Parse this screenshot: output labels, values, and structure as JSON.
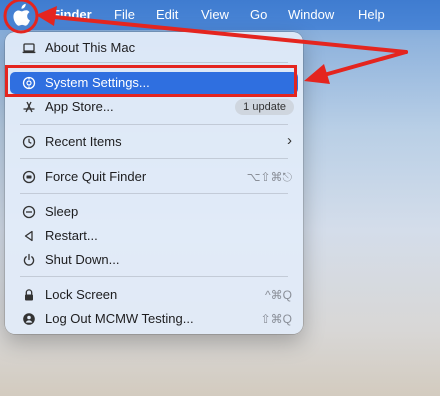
{
  "menubar": {
    "app_name": "Finder",
    "items": [
      "File",
      "Edit",
      "View",
      "Go",
      "Window",
      "Help"
    ]
  },
  "apple_menu": {
    "items": [
      {
        "label": "About This Mac",
        "icon": "laptop-icon"
      },
      {
        "label": "System Settings...",
        "icon": "gear-icon",
        "selected": true
      },
      {
        "label": "App Store...",
        "icon": "app-store-icon",
        "badge": "1 update"
      },
      {
        "label": "Recent Items",
        "icon": "clock-icon",
        "submenu": true
      },
      {
        "label": "Force Quit Finder",
        "icon": "force-quit-icon",
        "shortcut": "⌥⇧⌘⎋"
      },
      {
        "label": "Sleep",
        "icon": "sleep-icon"
      },
      {
        "label": "Restart...",
        "icon": "restart-icon"
      },
      {
        "label": "Shut Down...",
        "icon": "power-icon"
      },
      {
        "label": "Lock Screen",
        "icon": "lock-icon",
        "shortcut": "^⌘Q"
      },
      {
        "label": "Log Out MCMW Testing...",
        "icon": "user-icon",
        "shortcut": "⇧⌘Q"
      }
    ]
  },
  "colors": {
    "menubar": "#4582d4",
    "selection": "#2f6fe0",
    "annotation_red": "#e4251f"
  }
}
